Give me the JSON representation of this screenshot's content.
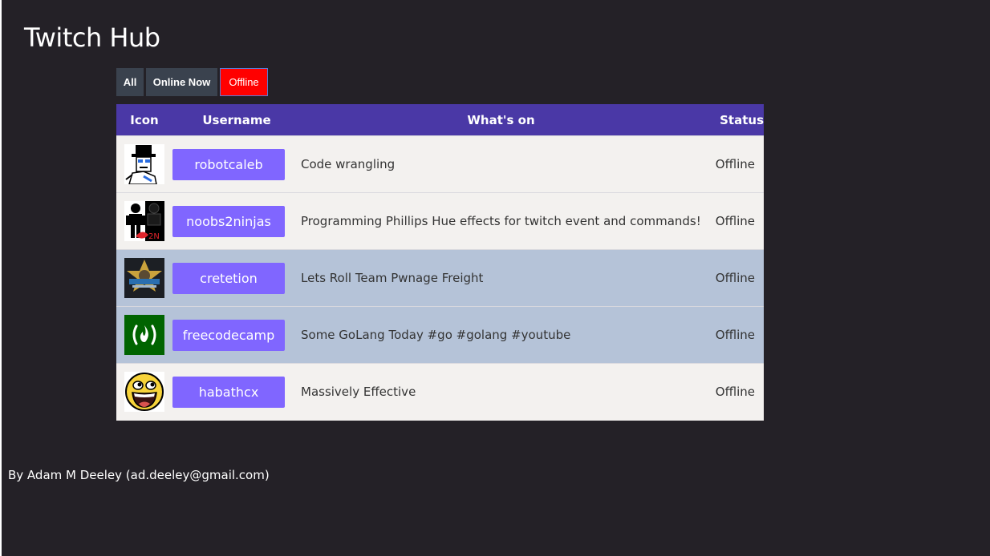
{
  "app": {
    "title": "Twitch Hub"
  },
  "filters": {
    "all_label": "All",
    "online_label": "Online Now",
    "offline_label": "Offline",
    "active": "Offline"
  },
  "table": {
    "headers": {
      "icon": "Icon",
      "username": "Username",
      "whats_on": "What's on",
      "status": "Status"
    },
    "rows": [
      {
        "username": "robotcaleb",
        "whats_on": "Code wrangling",
        "status": "Offline",
        "avatar_icon": "robot-top-hat-icon"
      },
      {
        "username": "noobs2ninjas",
        "whats_on": "Programming Phillips Hue effects for twitch event and commands!",
        "status": "Offline",
        "avatar_icon": "noob-ninja-icon"
      },
      {
        "username": "cretetion",
        "whats_on": "Lets Roll Team Pwnage Freight",
        "status": "Offline",
        "avatar_icon": "sheriff-star-icon"
      },
      {
        "username": "freecodecamp",
        "whats_on": "Some GoLang Today #go #golang #youtube",
        "status": "Offline",
        "avatar_icon": "campfire-icon"
      },
      {
        "username": "habathcx",
        "whats_on": "Massively Effective",
        "status": "Offline",
        "avatar_icon": "awesome-face-icon"
      }
    ]
  },
  "footer": {
    "credit": "By Adam M Deeley (ad.deeley@gmail.com)"
  },
  "colors": {
    "background": "#242127",
    "header_bar": "#4a38a6",
    "username_button": "#8066ff",
    "filter_active": "#ff0000",
    "filter_inactive": "#3a424e",
    "row_light": "#f3f1ef",
    "row_highlight": "#b5c3d8"
  }
}
